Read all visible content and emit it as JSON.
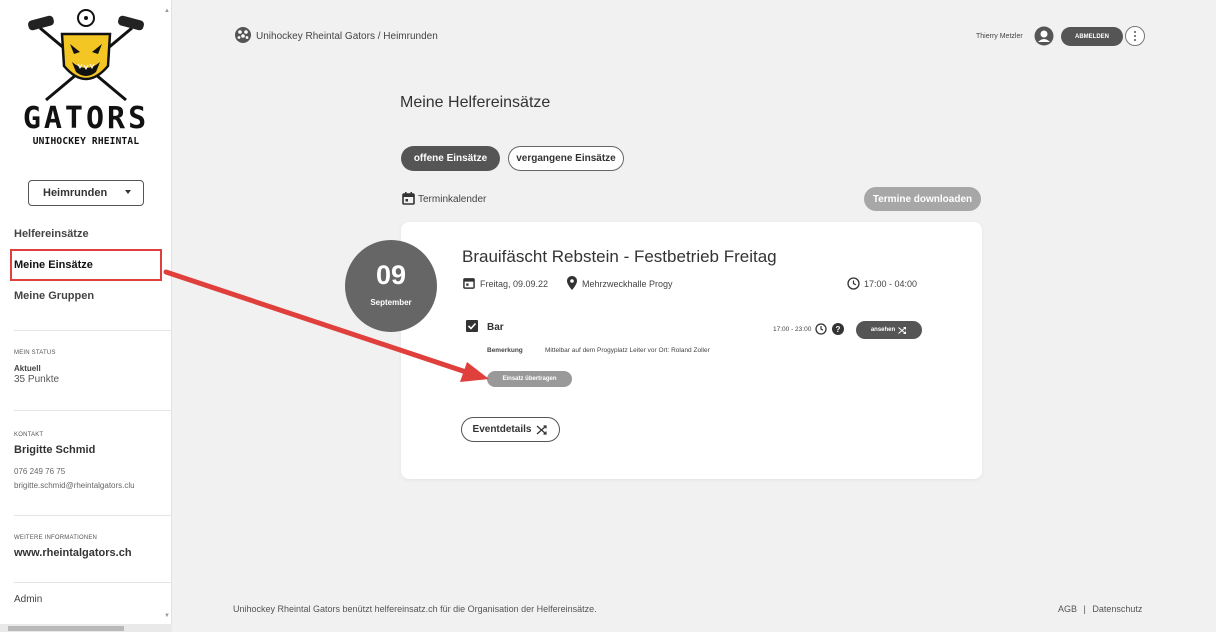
{
  "logo": {
    "main": "GATORS",
    "sub": "UNIHOCKEY RHEINTAL"
  },
  "sidebar": {
    "select_value": "Heimrunden",
    "items": [
      {
        "label": "Helfereinsätze"
      },
      {
        "label": "Meine Einsätze"
      },
      {
        "label": "Meine Gruppen"
      }
    ],
    "status": {
      "heading": "MEIN STATUS",
      "label": "Aktuell",
      "points": "35 Punkte"
    },
    "contact": {
      "heading": "KONTAKT",
      "name": "Brigitte Schmid",
      "phone": "076 249 76 75",
      "email": "brigitte.schmid@rheintalgators.clu"
    },
    "more": {
      "heading": "WEITERE INFORMATIONEN",
      "link": "www.rheintalgators.ch"
    },
    "admin": "Admin"
  },
  "header": {
    "breadcrumb": "Unihockey Rheintal Gators / Heimrunden",
    "user_name": "Thierry Metzler",
    "logout_label": "ABMELDEN"
  },
  "main": {
    "title": "Meine Helfereinsätze",
    "tabs": [
      {
        "label": "offene Einsätze",
        "active": true
      },
      {
        "label": "vergangene Einsätze",
        "active": false
      }
    ],
    "calendar_label": "Terminkalender",
    "download_label": "Termine downloaden"
  },
  "event": {
    "day": "09",
    "month": "September",
    "title": "Brauifäscht Rebstein - Festbetrieb Freitag",
    "date": "Freitag, 09.09.22",
    "location": "Mehrzweckhalle Progy",
    "time": "17:00 - 04:00",
    "shift": {
      "name": "Bar",
      "time": "17:00 - 23:00",
      "view_label": "ansehen",
      "remark_label": "Bemerkung",
      "remark": "Mittelbar auf dem Progyplatz Leiter vor Ort: Roland Zoller",
      "transfer_label": "Einsatz übertragen"
    },
    "details_label": "Eventdetails"
  },
  "footer": {
    "text": "Unihockey Rheintal Gators benützt helfereinsatz.ch für die Organisation der Helfereinsätze.",
    "agb": "AGB",
    "separator": "|",
    "privacy": "Datenschutz"
  },
  "colors": {
    "annotation": "#e0403c",
    "dark_button": "#555555",
    "logo_yellow": "#f3c623"
  }
}
